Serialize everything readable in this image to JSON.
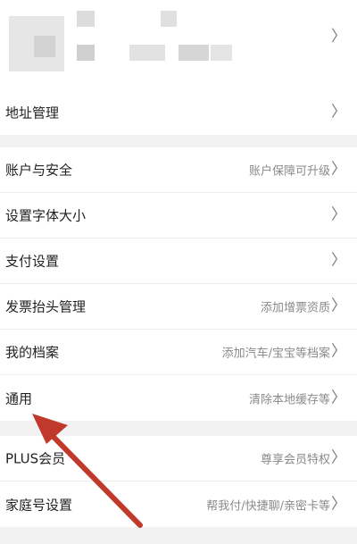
{
  "profile": {
    "chevron_icon": "chevron-right-icon"
  },
  "groups": [
    {
      "rows": [
        {
          "label": "地址管理",
          "hint": ""
        }
      ]
    },
    {
      "rows": [
        {
          "label": "账户与安全",
          "hint": "账户保障可升级"
        },
        {
          "label": "设置字体大小",
          "hint": ""
        },
        {
          "label": "支付设置",
          "hint": ""
        },
        {
          "label": "发票抬头管理",
          "hint": "添加增票资质"
        },
        {
          "label": "我的档案",
          "hint": "添加汽车/宝宝等档案"
        },
        {
          "label": "通用",
          "hint": "清除本地缓存等"
        }
      ]
    },
    {
      "rows": [
        {
          "label": "PLUS会员",
          "hint": "尊享会员特权"
        },
        {
          "label": "家庭号设置",
          "hint": "帮我付/快捷聊/亲密卡等"
        }
      ]
    }
  ],
  "colors": {
    "annotation_arrow": "#c0392b",
    "chevron": "#7a7a7a",
    "hint": "#8a8a8a"
  }
}
